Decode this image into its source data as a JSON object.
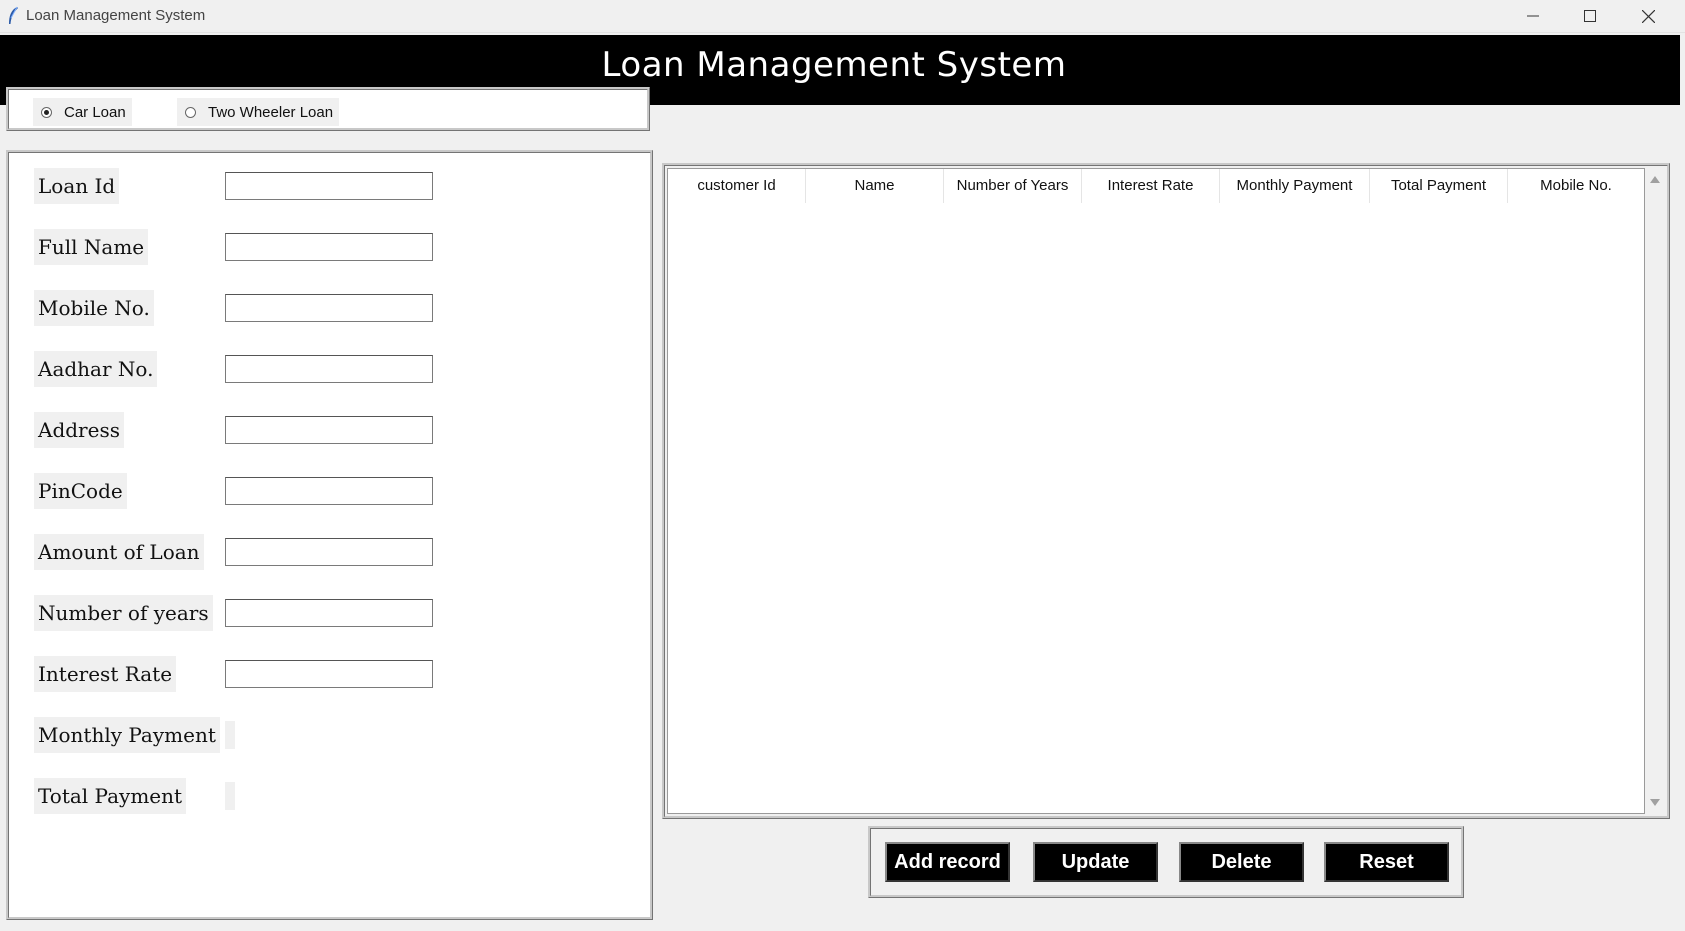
{
  "window": {
    "title": "Loan Management System",
    "controls": {
      "minimize": "minimize-icon",
      "maximize": "maximize-icon",
      "close": "close-icon"
    }
  },
  "header": {
    "title": "Loan Management System"
  },
  "loan_type": {
    "options": [
      {
        "label": "Car Loan",
        "selected": true
      },
      {
        "label": "Two Wheeler Loan",
        "selected": false
      }
    ]
  },
  "form": {
    "fields": [
      {
        "label": "Loan Id",
        "value": ""
      },
      {
        "label": "Full Name",
        "value": ""
      },
      {
        "label": "Mobile No.",
        "value": ""
      },
      {
        "label": "Aadhar No.",
        "value": ""
      },
      {
        "label": "Address",
        "value": ""
      },
      {
        "label": "PinCode",
        "value": ""
      },
      {
        "label": "Amount of Loan",
        "value": ""
      },
      {
        "label": "Number of years",
        "value": ""
      },
      {
        "label": "Interest Rate",
        "value": ""
      }
    ],
    "readouts": [
      {
        "label": "Monthly Payment",
        "value": ""
      },
      {
        "label": "Total Payment",
        "value": ""
      }
    ]
  },
  "table": {
    "columns": [
      "customer Id",
      "Name",
      "Number of Years",
      "Interest Rate",
      "Monthly Payment",
      "Total Payment",
      "Mobile No."
    ],
    "rows": []
  },
  "actions": {
    "add": "Add record",
    "update": "Update",
    "delete": "Delete",
    "reset": "Reset"
  }
}
